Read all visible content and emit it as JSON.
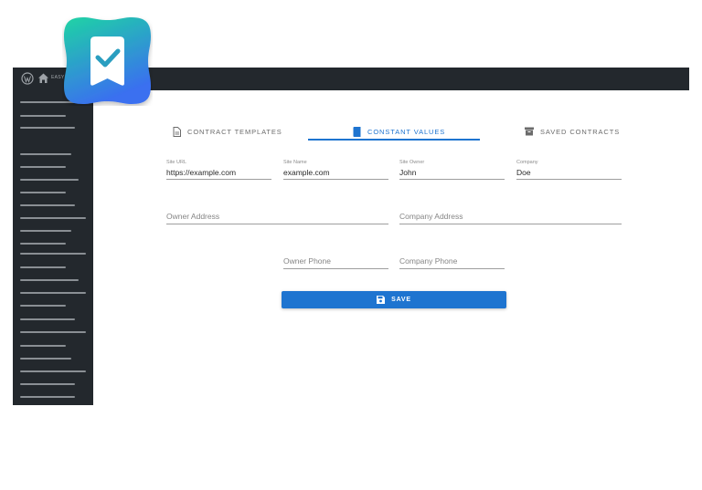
{
  "adminbar": {
    "site_name": "EASY"
  },
  "tabs": [
    {
      "label": "CONTRACT TEMPLATES",
      "icon": "document-icon",
      "active": false
    },
    {
      "label": "CONSTANT VALUES",
      "icon": "bookmark-icon",
      "active": true
    },
    {
      "label": "SAVED CONTRACTS",
      "icon": "archive-icon",
      "active": false
    }
  ],
  "fields": {
    "site_url": {
      "label": "Site URL",
      "value": "https://example.com"
    },
    "site_name": {
      "label": "Site Name",
      "value": "example.com"
    },
    "site_owner": {
      "label": "Site Owner",
      "value": "John"
    },
    "company": {
      "label": "Company",
      "value": "Doe"
    },
    "owner_address": {
      "placeholder": "Owner Address"
    },
    "company_address": {
      "placeholder": "Company Address"
    },
    "owner_phone": {
      "placeholder": "Owner Phone"
    },
    "company_phone": {
      "placeholder": "Company Phone"
    }
  },
  "save_button": {
    "label": "SAVE",
    "icon": "floppy-disk-icon"
  },
  "colors": {
    "accent": "#1e74d0",
    "admin_dark": "#23282d",
    "logo_gradient_top": "#1ed4a4",
    "logo_gradient_bottom": "#3a6ff0"
  }
}
